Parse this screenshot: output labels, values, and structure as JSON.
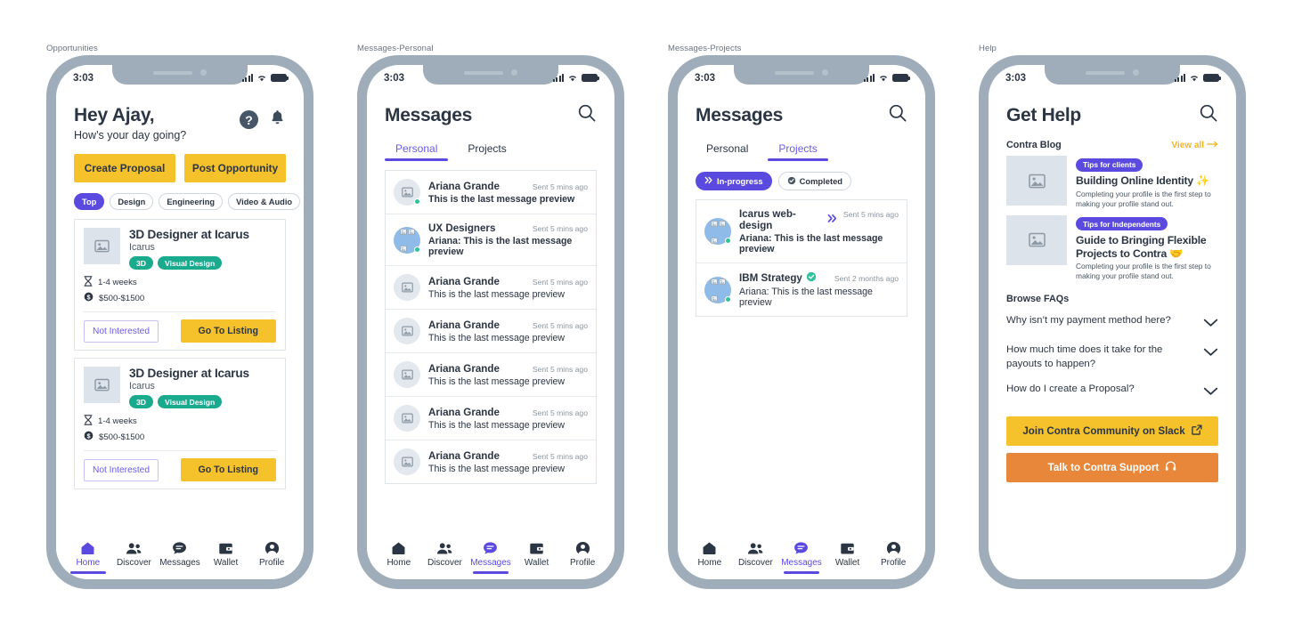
{
  "frames": [
    {
      "label": "Opportunities"
    },
    {
      "label": "Messages-Personal"
    },
    {
      "label": "Messages-Projects"
    },
    {
      "label": "Help"
    }
  ],
  "status_bar": {
    "time": "3:03",
    "signal_icon": "cellular-bars-icon",
    "wifi_icon": "wifi-icon",
    "battery_icon": "battery-full-icon"
  },
  "nav": {
    "items": [
      {
        "label": "Home",
        "icon": "home-icon"
      },
      {
        "label": "Discover",
        "icon": "people-icon"
      },
      {
        "label": "Messages",
        "icon": "chat-bubble-icon"
      },
      {
        "label": "Wallet",
        "icon": "wallet-icon"
      },
      {
        "label": "Profile",
        "icon": "person-circle-icon"
      }
    ]
  },
  "colors": {
    "accent_purple": "#5b4ae0",
    "yellow": "#f5c22c",
    "teal": "#1aab8f",
    "orange": "#e8873a",
    "frame_gray": "#9fadba",
    "text_dark": "#2b3543"
  },
  "opportunities": {
    "greeting": "Hey Ajay,",
    "subgreeting": "How’s your day going?",
    "help_icon": "question-mark-circle-icon",
    "bell_icon": "notification-bell-icon",
    "cta": {
      "create": "Create Proposal",
      "post": "Post Opportunity"
    },
    "chips": [
      {
        "label": "Top",
        "selected": true
      },
      {
        "label": "Design",
        "selected": false
      },
      {
        "label": "Engineering",
        "selected": false
      },
      {
        "label": "Video & Audio",
        "selected": false
      }
    ],
    "cards": [
      {
        "title": "3D Designer at Icarus",
        "company": "Icarus",
        "tags": [
          "3D",
          "Visual Design"
        ],
        "duration": "1-4 weeks",
        "duration_icon": "hourglass-icon",
        "budget": "$500-$1500",
        "budget_icon": "dollar-coin-icon",
        "reject_label": "Not Interested",
        "accept_label": "Go To Listing",
        "thumb_icon": "image-placeholder-icon"
      },
      {
        "title": "3D Designer at Icarus",
        "company": "Icarus",
        "tags": [
          "3D",
          "Visual Design"
        ],
        "duration": "1-4 weeks",
        "duration_icon": "hourglass-icon",
        "budget": "$500-$1500",
        "budget_icon": "dollar-coin-icon",
        "reject_label": "Not Interested",
        "accept_label": "Go To Listing",
        "thumb_icon": "image-placeholder-icon"
      }
    ]
  },
  "messages_personal": {
    "title": "Messages",
    "search_icon": "search-icon",
    "tabs": [
      {
        "label": "Personal",
        "active": true
      },
      {
        "label": "Projects",
        "active": false
      }
    ],
    "conversations": [
      {
        "name": "Ariana Grande",
        "time": "Sent 5 mins ago",
        "preview": "This is the last message preview",
        "group": false,
        "bold": true
      },
      {
        "name": "UX Designers",
        "time": "Sent 5 mins ago",
        "preview": "Ariana: This is the last message preview",
        "group": true,
        "bold": true
      },
      {
        "name": "Ariana Grande",
        "time": "Sent 5 mins ago",
        "preview": "This is the last message preview",
        "group": false,
        "bold": false
      },
      {
        "name": "Ariana Grande",
        "time": "Sent 5 mins ago",
        "preview": "This is the last message preview",
        "group": false,
        "bold": false
      },
      {
        "name": "Ariana Grande",
        "time": "Sent 5 mins ago",
        "preview": "This is the last message preview",
        "group": false,
        "bold": false
      },
      {
        "name": "Ariana Grande",
        "time": "Sent 5 mins ago",
        "preview": "This is the last message preview",
        "group": false,
        "bold": false
      },
      {
        "name": "Ariana Grande",
        "time": "Sent 5 mins ago",
        "preview": "This is the last message preview",
        "group": false,
        "bold": false
      }
    ]
  },
  "messages_projects": {
    "title": "Messages",
    "search_icon": "search-icon",
    "tabs": [
      {
        "label": "Personal",
        "active": false
      },
      {
        "label": "Projects",
        "active": true
      }
    ],
    "filters": [
      {
        "label": "In-progress",
        "icon": "double-chevron-right-icon",
        "on": true
      },
      {
        "label": "Completed",
        "icon": "check-circle-icon",
        "on": false
      }
    ],
    "conversations": [
      {
        "name": "Icarus web-design",
        "status_icon": "double-chevron-right-icon",
        "time": "Sent 5 mins ago",
        "preview": "Ariana: This is the last message preview",
        "bold": true
      },
      {
        "name": "IBM Strategy",
        "status_icon": "check-circle-icon",
        "time": "Sent 2 months ago",
        "preview": "Ariana: This is the last message preview",
        "bold": false
      }
    ]
  },
  "help": {
    "title": "Get Help",
    "search_icon": "search-icon",
    "blog_section_label": "Contra Blog",
    "view_all": "View all",
    "view_all_icon": "arrow-right-icon",
    "posts": [
      {
        "badge": "Tips for clients",
        "title": "Building Online Identity ✨",
        "desc": "Completing your profile is the first step to making your profile stand out.",
        "thumb_icon": "image-placeholder-icon"
      },
      {
        "badge": "Tips for Independents",
        "title": "Guide to Bringing Flexible Projects to Contra 🤝",
        "desc": "Completing your profile is the first step to making your profile stand out.",
        "thumb_icon": "image-placeholder-icon"
      }
    ],
    "faq_label": "Browse FAQs",
    "faqs": [
      {
        "question": "Why isn’t my payment method here?",
        "icon": "chevron-down-icon"
      },
      {
        "question": "How much time does it take for the payouts to happen?",
        "icon": "chevron-down-icon"
      },
      {
        "question": "How do I create a Proposal?",
        "icon": "chevron-down-icon"
      }
    ],
    "buttons": [
      {
        "label": "Join Contra Community on Slack",
        "icon": "external-link-icon",
        "style": "slack"
      },
      {
        "label": "Talk to Contra Support",
        "icon": "headset-icon",
        "style": "support"
      }
    ]
  }
}
